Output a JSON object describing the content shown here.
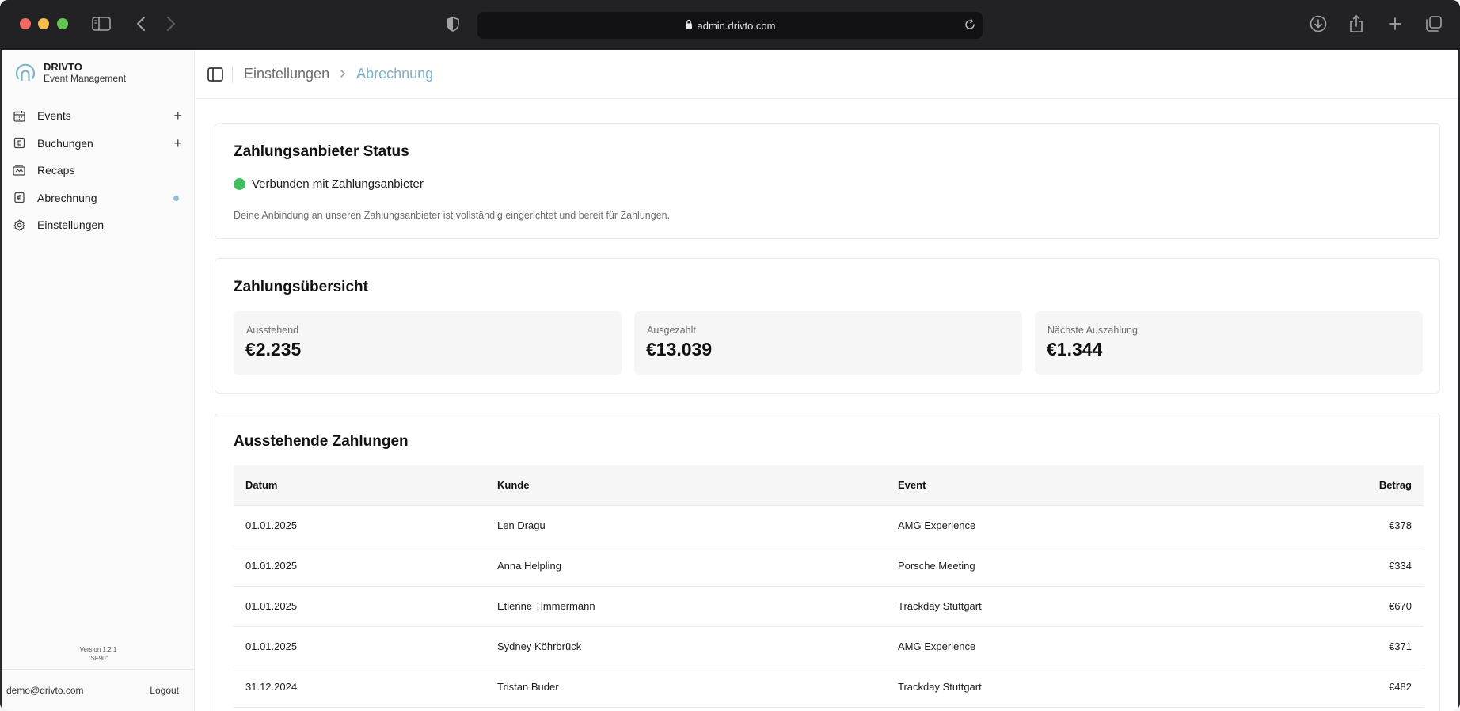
{
  "browser": {
    "url": "admin.drivto.com"
  },
  "brand": {
    "name": "DRIVTO",
    "subtitle": "Event Management"
  },
  "sidebar": {
    "items": [
      {
        "label": "Events",
        "icon": "calendar-icon",
        "has_add": true
      },
      {
        "label": "Buchungen",
        "icon": "booking-icon",
        "has_add": true
      },
      {
        "label": "Recaps",
        "icon": "recap-icon"
      },
      {
        "label": "Abrechnung",
        "icon": "billing-icon",
        "active_dot": true
      },
      {
        "label": "Einstellungen",
        "icon": "gear-icon"
      }
    ],
    "version_line1": "Version 1.2.1",
    "version_line2": "\"SF90\"",
    "user_email": "demo@drivto.com",
    "logout_label": "Logout"
  },
  "breadcrumb": {
    "parent": "Einstellungen",
    "current": "Abrechnung"
  },
  "provider_status": {
    "title": "Zahlungsanbieter Status",
    "status_text": "Verbunden mit Zahlungsanbieter",
    "description": "Deine Anbindung an unseren Zahlungsanbieter ist vollständig eingerichtet und bereit für Zahlungen."
  },
  "overview": {
    "title": "Zahlungsübersicht",
    "stats": [
      {
        "label": "Ausstehend",
        "value": "€2.235"
      },
      {
        "label": "Ausgezahlt",
        "value": "€13.039"
      },
      {
        "label": "Nächste Auszahlung",
        "value": "€1.344"
      }
    ]
  },
  "pending": {
    "title": "Ausstehende Zahlungen",
    "columns": [
      "Datum",
      "Kunde",
      "Event",
      "Betrag"
    ],
    "rows": [
      [
        "01.01.2025",
        "Len Dragu",
        "AMG Experience",
        "€378"
      ],
      [
        "01.01.2025",
        "Anna Helpling",
        "Porsche Meeting",
        "€334"
      ],
      [
        "01.01.2025",
        "Etienne Timmermann",
        "Trackday Stuttgart",
        "€670"
      ],
      [
        "01.01.2025",
        "Sydney Köhrbrück",
        "AMG Experience",
        "€371"
      ],
      [
        "31.12.2024",
        "Tristan Buder",
        "Trackday Stuttgart",
        "€482"
      ]
    ]
  },
  "colors": {
    "accent": "#7fb3c7",
    "status_ok": "#3fbf5f",
    "active_dot": "#8ec3d6"
  }
}
